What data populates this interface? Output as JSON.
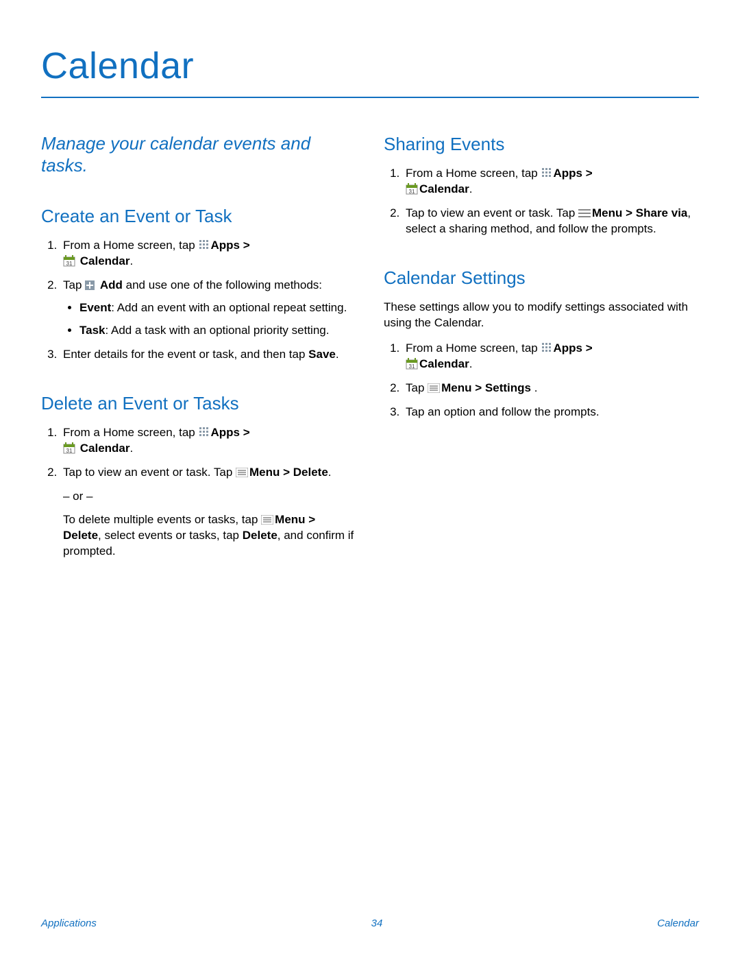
{
  "page_title": "Calendar",
  "intro": "Manage your calendar events and tasks.",
  "left": {
    "create": {
      "heading": "Create an Event or Task",
      "step1_pre": "From a Home screen, tap ",
      "apps_label": "Apps",
      "gt": " > ",
      "calendar_label": "Calendar",
      "period": ".",
      "step2_pre": "Tap ",
      "add_label": "Add",
      "step2_post": " and use one of the following methods:",
      "bullet1_label": "Event",
      "bullet1_text": ": Add an event with an optional repeat setting.",
      "bullet2_label": "Task",
      "bullet2_text": ": Add a task with an optional priority setting.",
      "step3_pre": "Enter details for the event or task, and then tap ",
      "save_label": "Save",
      "step3_post": "."
    },
    "delete": {
      "heading": "Delete an Event or Tasks",
      "step1_pre": "From a Home screen, tap ",
      "step2_pre": "Tap to view an event or task. Tap ",
      "menu_label": "Menu",
      "gt": " > ",
      "delete_label": "Delete",
      "period": ".",
      "or_text": "– or –",
      "multi_pre": "To delete multiple events or tasks, tap ",
      "multi_mid1": " > ",
      "multi_mid2": ", select events or tasks, tap ",
      "multi_post": ", and confirm if prompted."
    }
  },
  "right": {
    "sharing": {
      "heading": "Sharing Events",
      "step1_pre": "From a Home screen, tap ",
      "apps_label": "Apps",
      "gt": " > ",
      "calendar_label": "Calendar",
      "period": ".",
      "step2_pre": "Tap to view an event or task. Tap ",
      "menu_label": "Menu",
      "share_label": "Share via",
      "step2_post": ", select a sharing method, and follow the prompts."
    },
    "settings": {
      "heading": "Calendar Settings",
      "intro": "These settings allow you to modify settings associated with using the Calendar.",
      "step1_pre": "From a Home screen, tap ",
      "step2_pre": "Tap ",
      "menu_label": "Menu",
      "gt": " > ",
      "settings_label": "Settings",
      "step2_post": " .",
      "step3": "Tap an option and follow the prompts."
    }
  },
  "footer": {
    "left": "Applications",
    "center": "34",
    "right": "Calendar"
  }
}
